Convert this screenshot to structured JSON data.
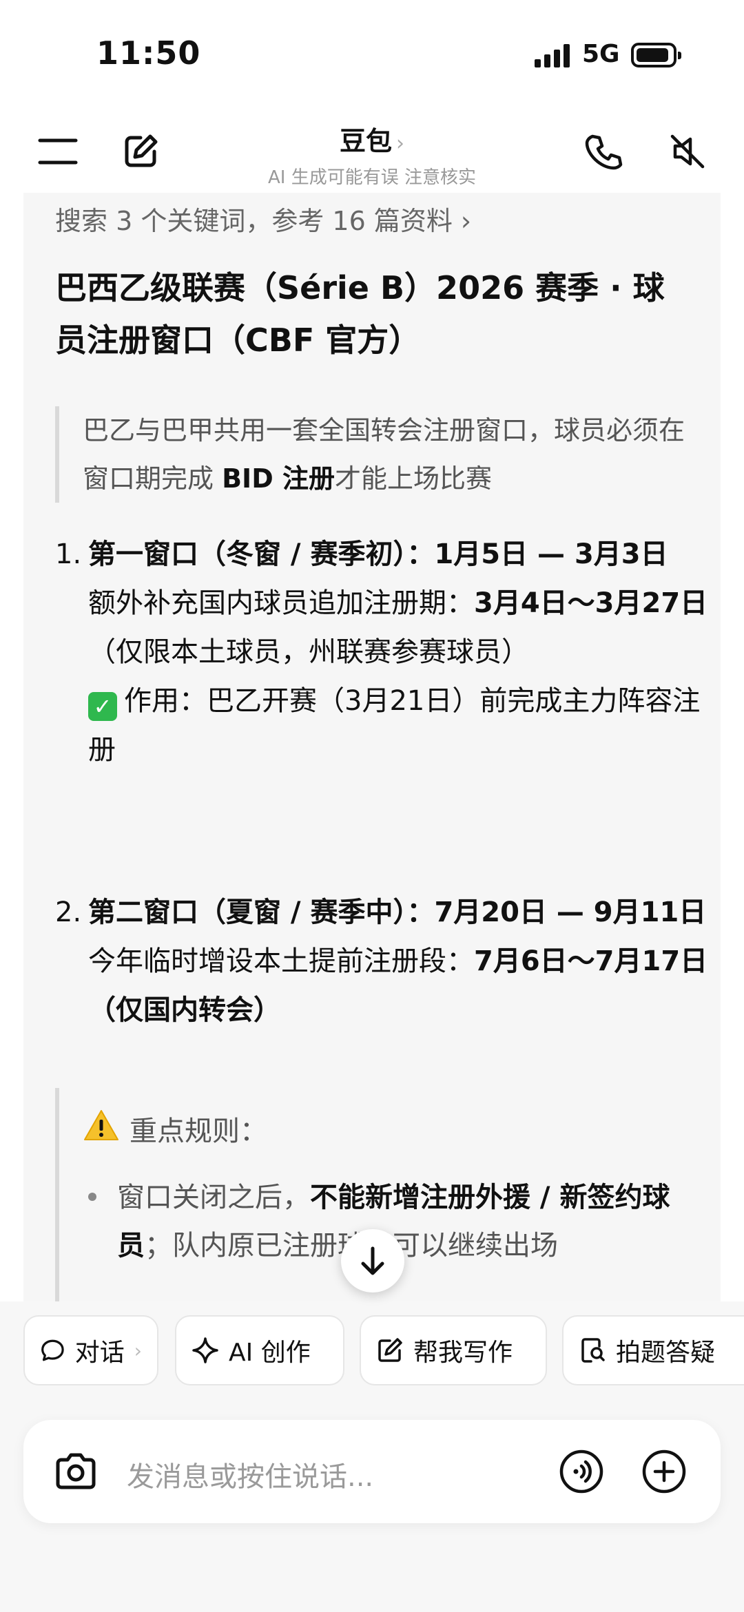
{
  "status": {
    "time": "11:50",
    "network": "5G"
  },
  "header": {
    "title": "豆包",
    "subtitle": "AI 生成可能有误 注意核实"
  },
  "content": {
    "search_summary": "搜索 3 个关键词，参考 16 篇资料 ›",
    "heading": "巴西乙级联赛（Série B）2026 赛季 · 球员注册窗口（CBF 官方）",
    "quote_plain": "巴乙与巴甲共用一套全国转会注册窗口，球员必须在窗口期完成 ",
    "quote_bold": "BID 注册",
    "quote_tail": "才能上场比赛",
    "item1": {
      "num": "1.",
      "title": "第一窗口（冬窗 / 赛季初）：1月5日 — 3月3日",
      "extra_plain": "额外补充国内球员追加注册期：",
      "extra_bold": "3月4日～3月27日",
      "extra_tail": "（仅限本土球员，州联赛参赛球员）",
      "note_text": "作用：巴乙开赛（3月21日）前完成主力阵容注册"
    },
    "item2": {
      "num": "2.",
      "title": "第二窗口（夏窗 / 赛季中）：7月20日 — 9月11日",
      "extra_plain": "今年临时增设本土提前注册段：",
      "extra_bold": "7月6日～7月17日（仅国内转会）"
    },
    "rules": {
      "title": "重点规则：",
      "bullet_plain": "窗口关闭之后，",
      "bullet_bold": "不能新增注册外援 / 新签约球员",
      "bullet_tail": "；队内原已注册球员可以继续出场"
    }
  },
  "chips": [
    {
      "label": "对话",
      "icon": "chat-bubble-icon"
    },
    {
      "label": "AI 创作",
      "icon": "sparkle-icon"
    },
    {
      "label": "帮我写作",
      "icon": "edit-icon"
    },
    {
      "label": "拍题答疑",
      "icon": "scan-doc-icon"
    }
  ],
  "input": {
    "placeholder": "发消息或按住说话..."
  }
}
